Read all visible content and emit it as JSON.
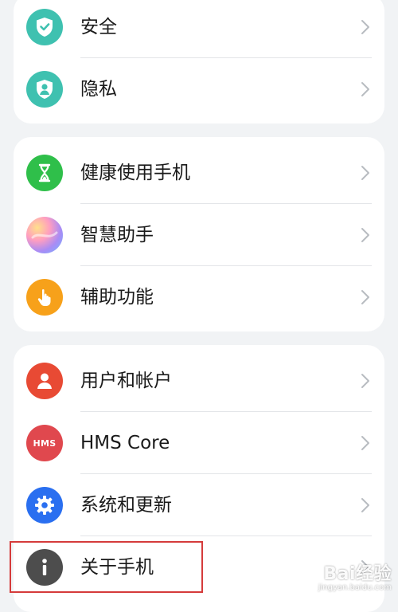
{
  "sections": [
    {
      "items": [
        {
          "label": "安全",
          "icon": "shield-check-icon",
          "color": "#3fc1b0"
        },
        {
          "label": "隐私",
          "icon": "privacy-person-icon",
          "color": "#3fc1b0"
        }
      ]
    },
    {
      "items": [
        {
          "label": "健康使用手机",
          "icon": "hourglass-icon",
          "color": "#2fbf4a"
        },
        {
          "label": "智慧助手",
          "icon": "assistant-orb-icon",
          "color": "#b58ff0"
        },
        {
          "label": "辅助功能",
          "icon": "hand-pointer-icon",
          "color": "#f7a11a"
        }
      ]
    },
    {
      "items": [
        {
          "label": "用户和帐户",
          "icon": "user-icon",
          "color": "#e84a34"
        },
        {
          "label": "HMS Core",
          "icon": "hms-icon",
          "color": "#e0484e",
          "icon_text": "HMS"
        },
        {
          "label": "系统和更新",
          "icon": "gear-icon",
          "color": "#2a6ff0"
        },
        {
          "label": "关于手机",
          "icon": "info-icon",
          "color": "#4d4d4d"
        }
      ]
    }
  ],
  "highlight_color": "#d53b3b",
  "watermark": {
    "main": "Bai经验",
    "sub": "jingyan.baidu.com"
  }
}
